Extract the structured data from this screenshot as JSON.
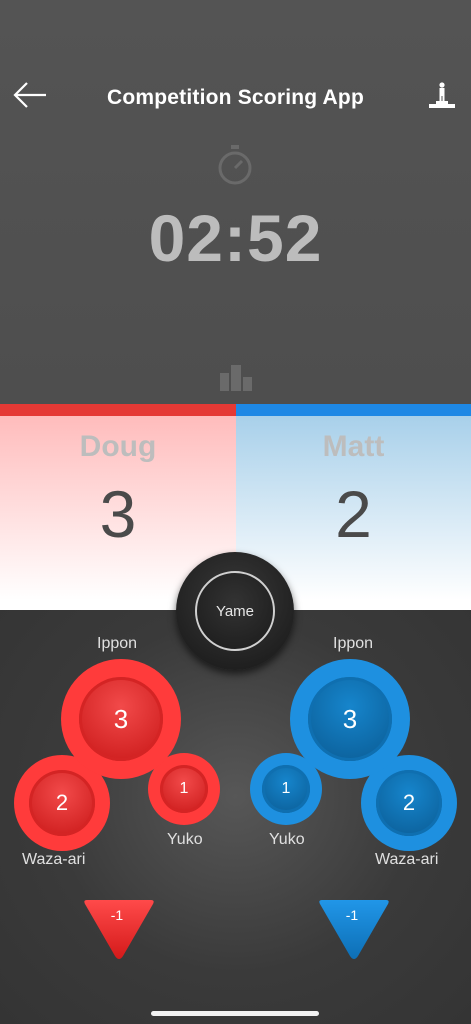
{
  "header": {
    "title": "Competition Scoring App",
    "back_icon": "arrow-left-icon",
    "podium_icon": "podium-icon"
  },
  "timer": {
    "value": "02:52",
    "stopwatch_icon": "stopwatch-icon",
    "ranking_icon": "ranking-icon"
  },
  "players": {
    "red": {
      "name": "Doug",
      "score": "3",
      "color": "#e53935"
    },
    "blue": {
      "name": "Matt",
      "score": "2",
      "color": "#1e88e5"
    }
  },
  "controls": {
    "yame": "Yame",
    "ippon_label": "Ippon",
    "wazaari_label": "Waza-ari",
    "yuko_label": "Yuko",
    "red": {
      "ippon": "3",
      "wazaari": "2",
      "yuko": "1",
      "penalty": "-1"
    },
    "blue": {
      "ippon": "3",
      "wazaari": "2",
      "yuko": "1",
      "penalty": "-1"
    }
  }
}
